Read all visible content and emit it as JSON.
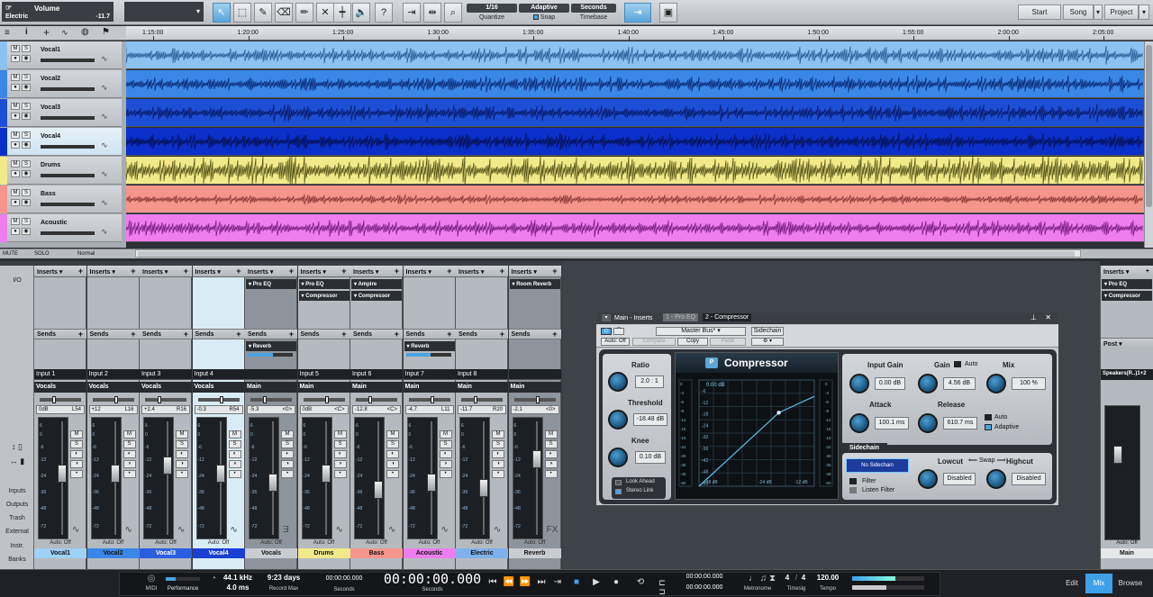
{
  "topbar": {
    "channel_label": "Volume",
    "channel_sub": "Electric",
    "channel_value": "-11.7",
    "quantize_value": "1/16",
    "quantize_label": "Quantize",
    "snap_mode": "Adaptive",
    "snap_label": "Snap",
    "timebase_value": "Seconds",
    "timebase_label": "Timebase",
    "right_buttons": [
      "Start",
      "Song",
      "Project"
    ]
  },
  "ruler": {
    "ticks": [
      "1:15:00",
      "1:20:00",
      "1:25:00",
      "1:30:00",
      "1:35:00",
      "1:40:00",
      "1:45:00",
      "1:50:00",
      "1:55:00",
      "2:00:00",
      "2:05:00"
    ]
  },
  "tracks": [
    {
      "name": "Vocal1",
      "color": "#8cc2f2"
    },
    {
      "name": "Vocal2",
      "color": "#3a87e8"
    },
    {
      "name": "Vocal3",
      "color": "#1c4fd6"
    },
    {
      "name": "Vocal4",
      "color": "#0b2fc9"
    },
    {
      "name": "Drums",
      "color": "#f2ea8a"
    },
    {
      "name": "Bass",
      "color": "#f5968c"
    },
    {
      "name": "Acoustic",
      "color": "#ee7ef0"
    }
  ],
  "bottombar": {
    "mute": "MUTE",
    "solo": "SOLO",
    "mode": "Normal"
  },
  "mixer_left": {
    "io": "I/O",
    "items": [
      "Inputs",
      "Outputs",
      "Trash",
      "External",
      "Instr.",
      "Banks"
    ]
  },
  "channels": [
    {
      "inserts": [],
      "input": "Input 1",
      "output": "Vocals",
      "pan": "0dB",
      "panpos": "L54",
      "name": "Vocal1",
      "namecolor": "#9fd0f5",
      "fader": 0.55
    },
    {
      "inserts": [],
      "input": "Input 2",
      "output": "Vocals",
      "pan": "+12",
      "panpos": "L16",
      "name": "Vocal2",
      "namecolor": "#3a87e8",
      "fader": 0.55
    },
    {
      "inserts": [],
      "input": "Input 3",
      "output": "Vocals",
      "pan": "+2.4",
      "panpos": "R16",
      "name": "Vocal3",
      "namecolor": "#2a5fe0",
      "fader": 0.63
    },
    {
      "inserts": [],
      "input": "Input 4",
      "output": "Vocals",
      "pan": "-0.3",
      "panpos": "R54",
      "name": "Vocal4",
      "namecolor": "#1a3fd2",
      "fader": 0.55,
      "selected": true
    },
    {
      "inserts": [
        "Pro EQ"
      ],
      "sends": [
        "Reverb"
      ],
      "input": "",
      "output": "Main",
      "pan": "-5.3",
      "panpos": "<0>",
      "name": "Vocals",
      "namecolor": "#c9cdd2",
      "fader": 0.45,
      "bus": true
    },
    {
      "inserts": [
        "Pro EQ",
        "Compressor"
      ],
      "input": "Input 5",
      "output": "Main",
      "pan": "0dB",
      "panpos": "<C>",
      "name": "Drums",
      "namecolor": "#f2ea8a",
      "fader": 0.55
    },
    {
      "inserts": [
        "Ampire",
        "Compressor"
      ],
      "input": "Input 6",
      "output": "Main",
      "pan": "-12.8",
      "panpos": "<C>",
      "name": "Bass",
      "namecolor": "#f5968c",
      "fader": 0.38
    },
    {
      "inserts": [],
      "sends": [
        "Reverb"
      ],
      "input": "Input 7",
      "output": "Main",
      "pan": "-4.7",
      "panpos": "L11",
      "name": "Acoustic",
      "namecolor": "#ee7ef0",
      "fader": 0.45
    },
    {
      "inserts": [],
      "input": "Input 8",
      "output": "Main",
      "pan": "-11.7",
      "panpos": "R20",
      "name": "Electric",
      "namecolor": "#7fb2ec",
      "fader": 0.4
    },
    {
      "inserts": [
        "Room Reverb"
      ],
      "input": "",
      "output": "Main",
      "pan": "-2.1",
      "panpos": "<0>",
      "name": "Reverb",
      "namecolor": "#c9cdd2",
      "fader": 0.7,
      "bus": true
    }
  ],
  "channel_labels": {
    "inserts": "Inserts",
    "sends": "Sends",
    "auto": "Auto: Off"
  },
  "db_scale": [
    "6",
    "0",
    "-6",
    "-12",
    "-24",
    "-36",
    "-48",
    "-72"
  ],
  "plugin": {
    "title": "Main - Inserts",
    "tabs": [
      "1 - Pro EQ",
      "2 - Compressor"
    ],
    "preset": "Master Bus*",
    "sidechain_btn": "Sidechain",
    "auto_off": "Auto: Off",
    "compare": "Compare",
    "copy": "Copy",
    "paste": "Paste",
    "name": "Compressor",
    "graph_readout": "0.00 dB",
    "ratio_label": "Ratio",
    "ratio_value": "2.0 : 1",
    "threshold_label": "Threshold",
    "threshold_value": "-18.48 dB",
    "knee_label": "Knee",
    "knee_value": "0.10 dB",
    "look_ahead": "Look Ahead",
    "stereo_link": "Stereo Link",
    "input_gain_label": "Input Gain",
    "input_gain_value": "0.00 dB",
    "gain_label": "Gain",
    "gain_auto": "Auto",
    "gain_value": "4.56 dB",
    "mix_label": "Mix",
    "mix_value": "100 %",
    "attack_label": "Attack",
    "attack_value": "100.1 ms",
    "release_label": "Release",
    "release_value": "610.7 ms",
    "auto_label": "Auto",
    "adaptive_label": "Adaptive",
    "sidechain_label": "Sidechain",
    "no_sidechain": "No Sidechain",
    "filter_label": "Filter",
    "listen_filter": "Listen Filter",
    "lowcut_label": "Lowcut",
    "swap_label": "Swap",
    "highcut_label": "Highcut",
    "lowcut_value": "Disabled",
    "highcut_value": "Disabled",
    "graph_scale": [
      "-6",
      "-12",
      "-18",
      "-24",
      "-30",
      "-36",
      "-42",
      "-48",
      "-60"
    ],
    "meter_scale": [
      "0",
      "-3",
      "-6",
      "-9",
      "-12",
      "-15",
      "-18",
      "-24",
      "-30",
      "-36",
      "-48",
      "-60"
    ],
    "graph_bottom": [
      "-48 dB",
      "-24 dB",
      "-12 dB"
    ]
  },
  "right_strip": {
    "inserts": [
      "Pro EQ",
      "Compressor"
    ],
    "post": "Post",
    "output": "Speakers(R..)1+2",
    "name": "Main",
    "auto": "Auto: Off"
  },
  "transport": {
    "midi": "MIDI",
    "performance": "Performance",
    "sample_rate": "44.1 kHz",
    "latency": "4.0 ms",
    "record_max_value": "9:23 days",
    "record_max_label": "Record Max",
    "seconds_small": "00:00:00.000",
    "seconds_label": "Seconds",
    "big_time": "00:00:00.000",
    "big_time_label": "Seconds",
    "loop_start": "00:00:00.000",
    "loop_end": "00:00:00.000",
    "metronome": "Metronome",
    "timesig_num": "4",
    "timesig_den": "4",
    "timesig_label": "Timesig",
    "tempo": "120.00",
    "tempo_label": "Tempo",
    "edit": "Edit",
    "mix": "Mix",
    "browse": "Browse"
  }
}
